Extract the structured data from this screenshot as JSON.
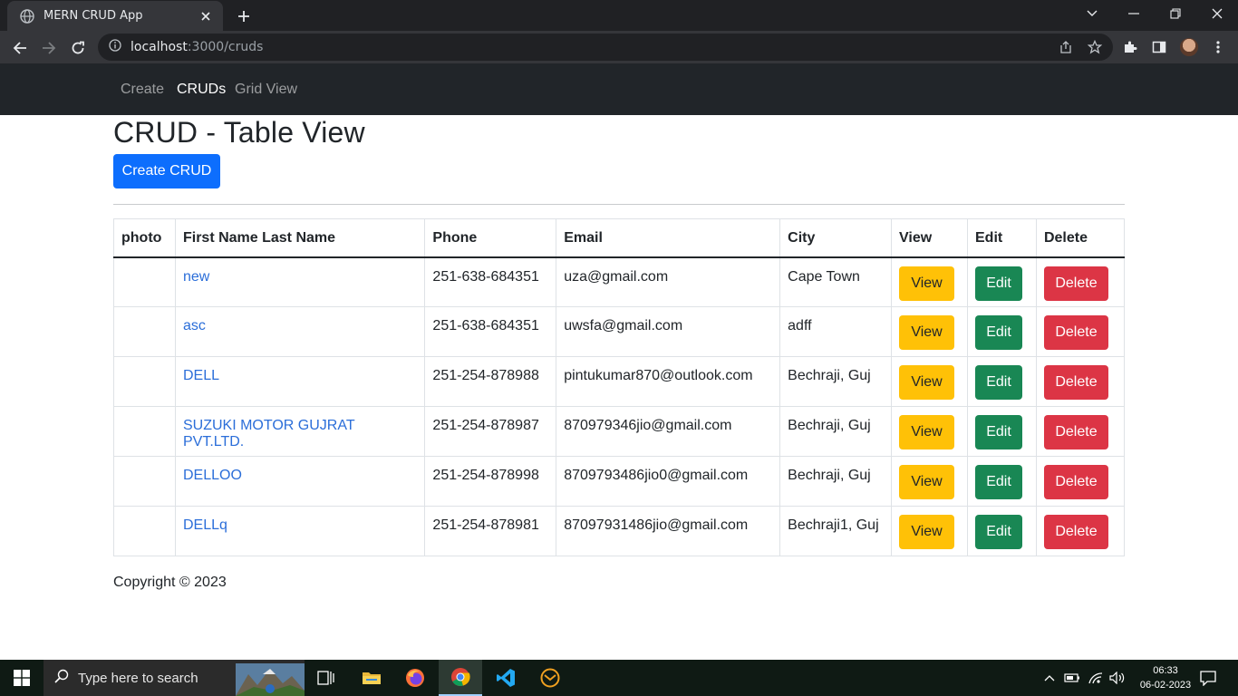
{
  "browser": {
    "tab_title": "MERN CRUD App",
    "url_host": "localhost",
    "url_path": ":3000/cruds"
  },
  "navbar": {
    "items": [
      {
        "label": "Create"
      },
      {
        "label": "CRUDs"
      },
      {
        "label": "Grid View"
      }
    ],
    "active": "CRUDs"
  },
  "page": {
    "title": "CRUD - Table View",
    "create_button": "Create CRUD"
  },
  "table": {
    "headers": [
      "photo",
      "First Name Last Name",
      "Phone",
      "Email",
      "City",
      "View",
      "Edit",
      "Delete"
    ],
    "rows": [
      {
        "name": "new",
        "phone": "251-638-684351",
        "email": "uza@gmail.com",
        "city": "Cape Town"
      },
      {
        "name": "asc",
        "phone": "251-638-684351",
        "email": "uwsfa@gmail.com",
        "city": "adff"
      },
      {
        "name": "DELL",
        "phone": "251-254-878988",
        "email": "pintukumar870@outlook.com",
        "city": "Bechraji, Guj"
      },
      {
        "name": "SUZUKI MOTOR GUJRAT PVT.LTD.",
        "phone": "251-254-878987",
        "email": "870979346jio@gmail.com",
        "city": "Bechraji, Guj"
      },
      {
        "name": "DELLOO",
        "phone": "251-254-878998",
        "email": "8709793486jio0@gmail.com",
        "city": "Bechraji, Guj"
      },
      {
        "name": "DELLq",
        "phone": "251-254-878981",
        "email": "87097931486jio@gmail.com",
        "city": "Bechraji1, Guj"
      }
    ],
    "view_label": "View",
    "edit_label": "Edit",
    "delete_label": "Delete"
  },
  "footer": {
    "text": "Copyright © 2023"
  },
  "taskbar": {
    "search_placeholder": "Type here to search",
    "time": "06:33",
    "date": "06-02-2023"
  },
  "colors": {
    "primary": "#0d6efd",
    "warning": "#ffc107",
    "success": "#198754",
    "danger": "#dc3545",
    "navbar": "#212529"
  }
}
